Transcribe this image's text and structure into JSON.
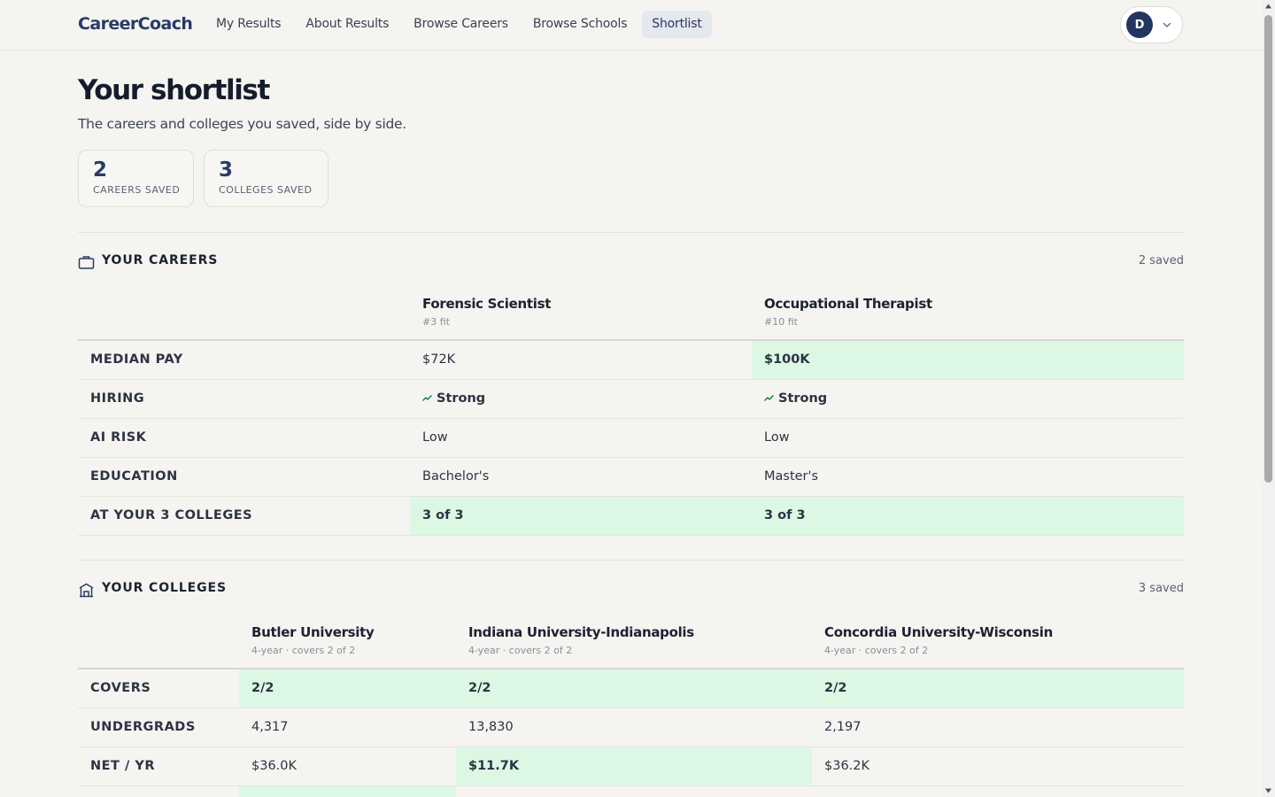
{
  "brand": {
    "logo": "CareerCoach"
  },
  "nav": {
    "items": [
      {
        "label": "My Results"
      },
      {
        "label": "About Results"
      },
      {
        "label": "Browse Careers"
      },
      {
        "label": "Browse Schools"
      },
      {
        "label": "Shortlist",
        "active": true
      }
    ]
  },
  "user": {
    "initial": "D",
    "icon": "chevron-down-icon"
  },
  "header": {
    "title": "Your shortlist",
    "subtitle": "The careers and colleges you saved, side by side."
  },
  "stats": [
    {
      "value": "2",
      "label": "CAREERS SAVED"
    },
    {
      "value": "3",
      "label": "COLLEGES SAVED"
    }
  ],
  "careers": {
    "title": "YOUR CAREERS",
    "icon": "briefcase-icon",
    "count": "2 saved",
    "columns": [
      {
        "name": "Forensic Scientist",
        "sub": "#3 fit"
      },
      {
        "name": "Occupational Therapist",
        "sub": "#10 fit"
      }
    ],
    "rows": [
      {
        "label": "MEDIAN PAY",
        "values": [
          "$72K",
          "$100K"
        ]
      },
      {
        "label": "HIRING",
        "values": [
          "Strong",
          "Strong"
        ]
      },
      {
        "label": "AI RISK",
        "values": [
          "Low",
          "Low"
        ]
      },
      {
        "label": "EDUCATION",
        "values": [
          "Bachelor's",
          "Master's"
        ]
      },
      {
        "label": "AT YOUR 3 COLLEGES",
        "values": [
          "3 of 3",
          "3 of 3"
        ]
      }
    ]
  },
  "colleges": {
    "title": "YOUR COLLEGES",
    "icon": "university-icon",
    "count": "3 saved",
    "columns": [
      {
        "name": "Butler University",
        "sub": "4-year · covers 2 of 2"
      },
      {
        "name": "Indiana University-Indianapolis",
        "sub": "4-year · covers 2 of 2"
      },
      {
        "name": "Concordia University-Wisconsin",
        "sub": "4-year · covers 2 of 2"
      }
    ],
    "rows": [
      {
        "label": "COVERS",
        "values": [
          "2/2",
          "2/2",
          "2/2"
        ]
      },
      {
        "label": "UNDERGRADS",
        "values": [
          "4,317",
          "13,830",
          "2,197"
        ]
      },
      {
        "label": "NET / YR",
        "values": [
          "$36.0K",
          "$11.7K",
          "$36.2K"
        ]
      }
    ]
  },
  "colors": {
    "brand": "#283b66",
    "highlight_bg": "#dcf8e4",
    "highlight_text": "#16803a",
    "background": "#f5f4f1"
  }
}
